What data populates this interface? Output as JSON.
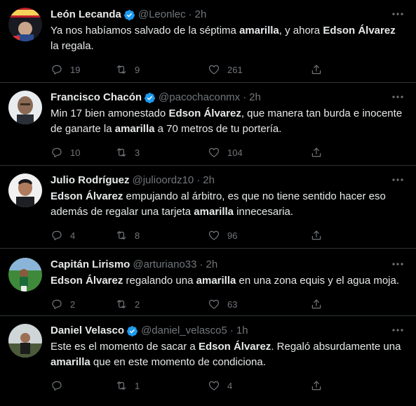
{
  "tweets": [
    {
      "name": "León Lecanda",
      "handle": "@Leonlec",
      "sep": "·",
      "time": "2h",
      "verified": true,
      "text_parts": [
        {
          "t": "Ya nos habíamos salvado de la séptima ",
          "b": false
        },
        {
          "t": "amarilla",
          "b": true
        },
        {
          "t": ", y ahora ",
          "b": false
        },
        {
          "t": "Edson Álvarez",
          "b": true
        },
        {
          "t": " la regala.",
          "b": false
        }
      ],
      "replies": "19",
      "retweets": "9",
      "likes": "261"
    },
    {
      "name": "Francisco Chacón",
      "handle": "@pacochaconmx",
      "sep": "·",
      "time": "2h",
      "verified": true,
      "text_parts": [
        {
          "t": "Min 17 bien amonestado ",
          "b": false
        },
        {
          "t": "Edson Álvarez",
          "b": true
        },
        {
          "t": ", que manera tan burda e inocente de ganarte la ",
          "b": false
        },
        {
          "t": "amarilla",
          "b": true
        },
        {
          "t": " a 70 metros de tu portería.",
          "b": false
        }
      ],
      "replies": "10",
      "retweets": "3",
      "likes": "104"
    },
    {
      "name": "Julio Rodríguez",
      "handle": "@julioordz10",
      "sep": "·",
      "time": "2h",
      "verified": false,
      "text_parts": [
        {
          "t": "Edson Álvarez",
          "b": true
        },
        {
          "t": " empujando al árbitro, es que no tiene sentido hacer eso además de regalar una tarjeta ",
          "b": false
        },
        {
          "t": "amarilla",
          "b": true
        },
        {
          "t": " innecesaria.",
          "b": false
        }
      ],
      "replies": "4",
      "retweets": "8",
      "likes": "96"
    },
    {
      "name": "Capitán Lirismo",
      "handle": "@arturiano33",
      "sep": "·",
      "time": "2h",
      "verified": false,
      "text_parts": [
        {
          "t": "Edson Álvarez",
          "b": true
        },
        {
          "t": " regalando una ",
          "b": false
        },
        {
          "t": "amarilla",
          "b": true
        },
        {
          "t": " en una zona equis y el agua moja.",
          "b": false
        }
      ],
      "replies": "2",
      "retweets": "2",
      "likes": "63"
    },
    {
      "name": "Daniel Velasco",
      "handle": "@daniel_velasco5",
      "sep": "·",
      "time": "1h",
      "verified": true,
      "text_parts": [
        {
          "t": "Este es el momento de sacar a ",
          "b": false
        },
        {
          "t": "Edson Álvarez",
          "b": true
        },
        {
          "t": ". Regaló absurdamente una ",
          "b": false
        },
        {
          "t": "amarilla",
          "b": true
        },
        {
          "t": " que en este momento de condiciona.",
          "b": false
        }
      ],
      "replies": "",
      "retweets": "1",
      "likes": "4"
    }
  ],
  "colors": {
    "background": "#000000",
    "text": "#e7e9ea",
    "muted": "#71767b",
    "verified": "#1d9bf0",
    "divider": "#2f3336"
  },
  "icons": [
    "reply-icon",
    "retweet-icon",
    "like-icon",
    "share-icon",
    "more-icon",
    "verified-badge-icon"
  ]
}
